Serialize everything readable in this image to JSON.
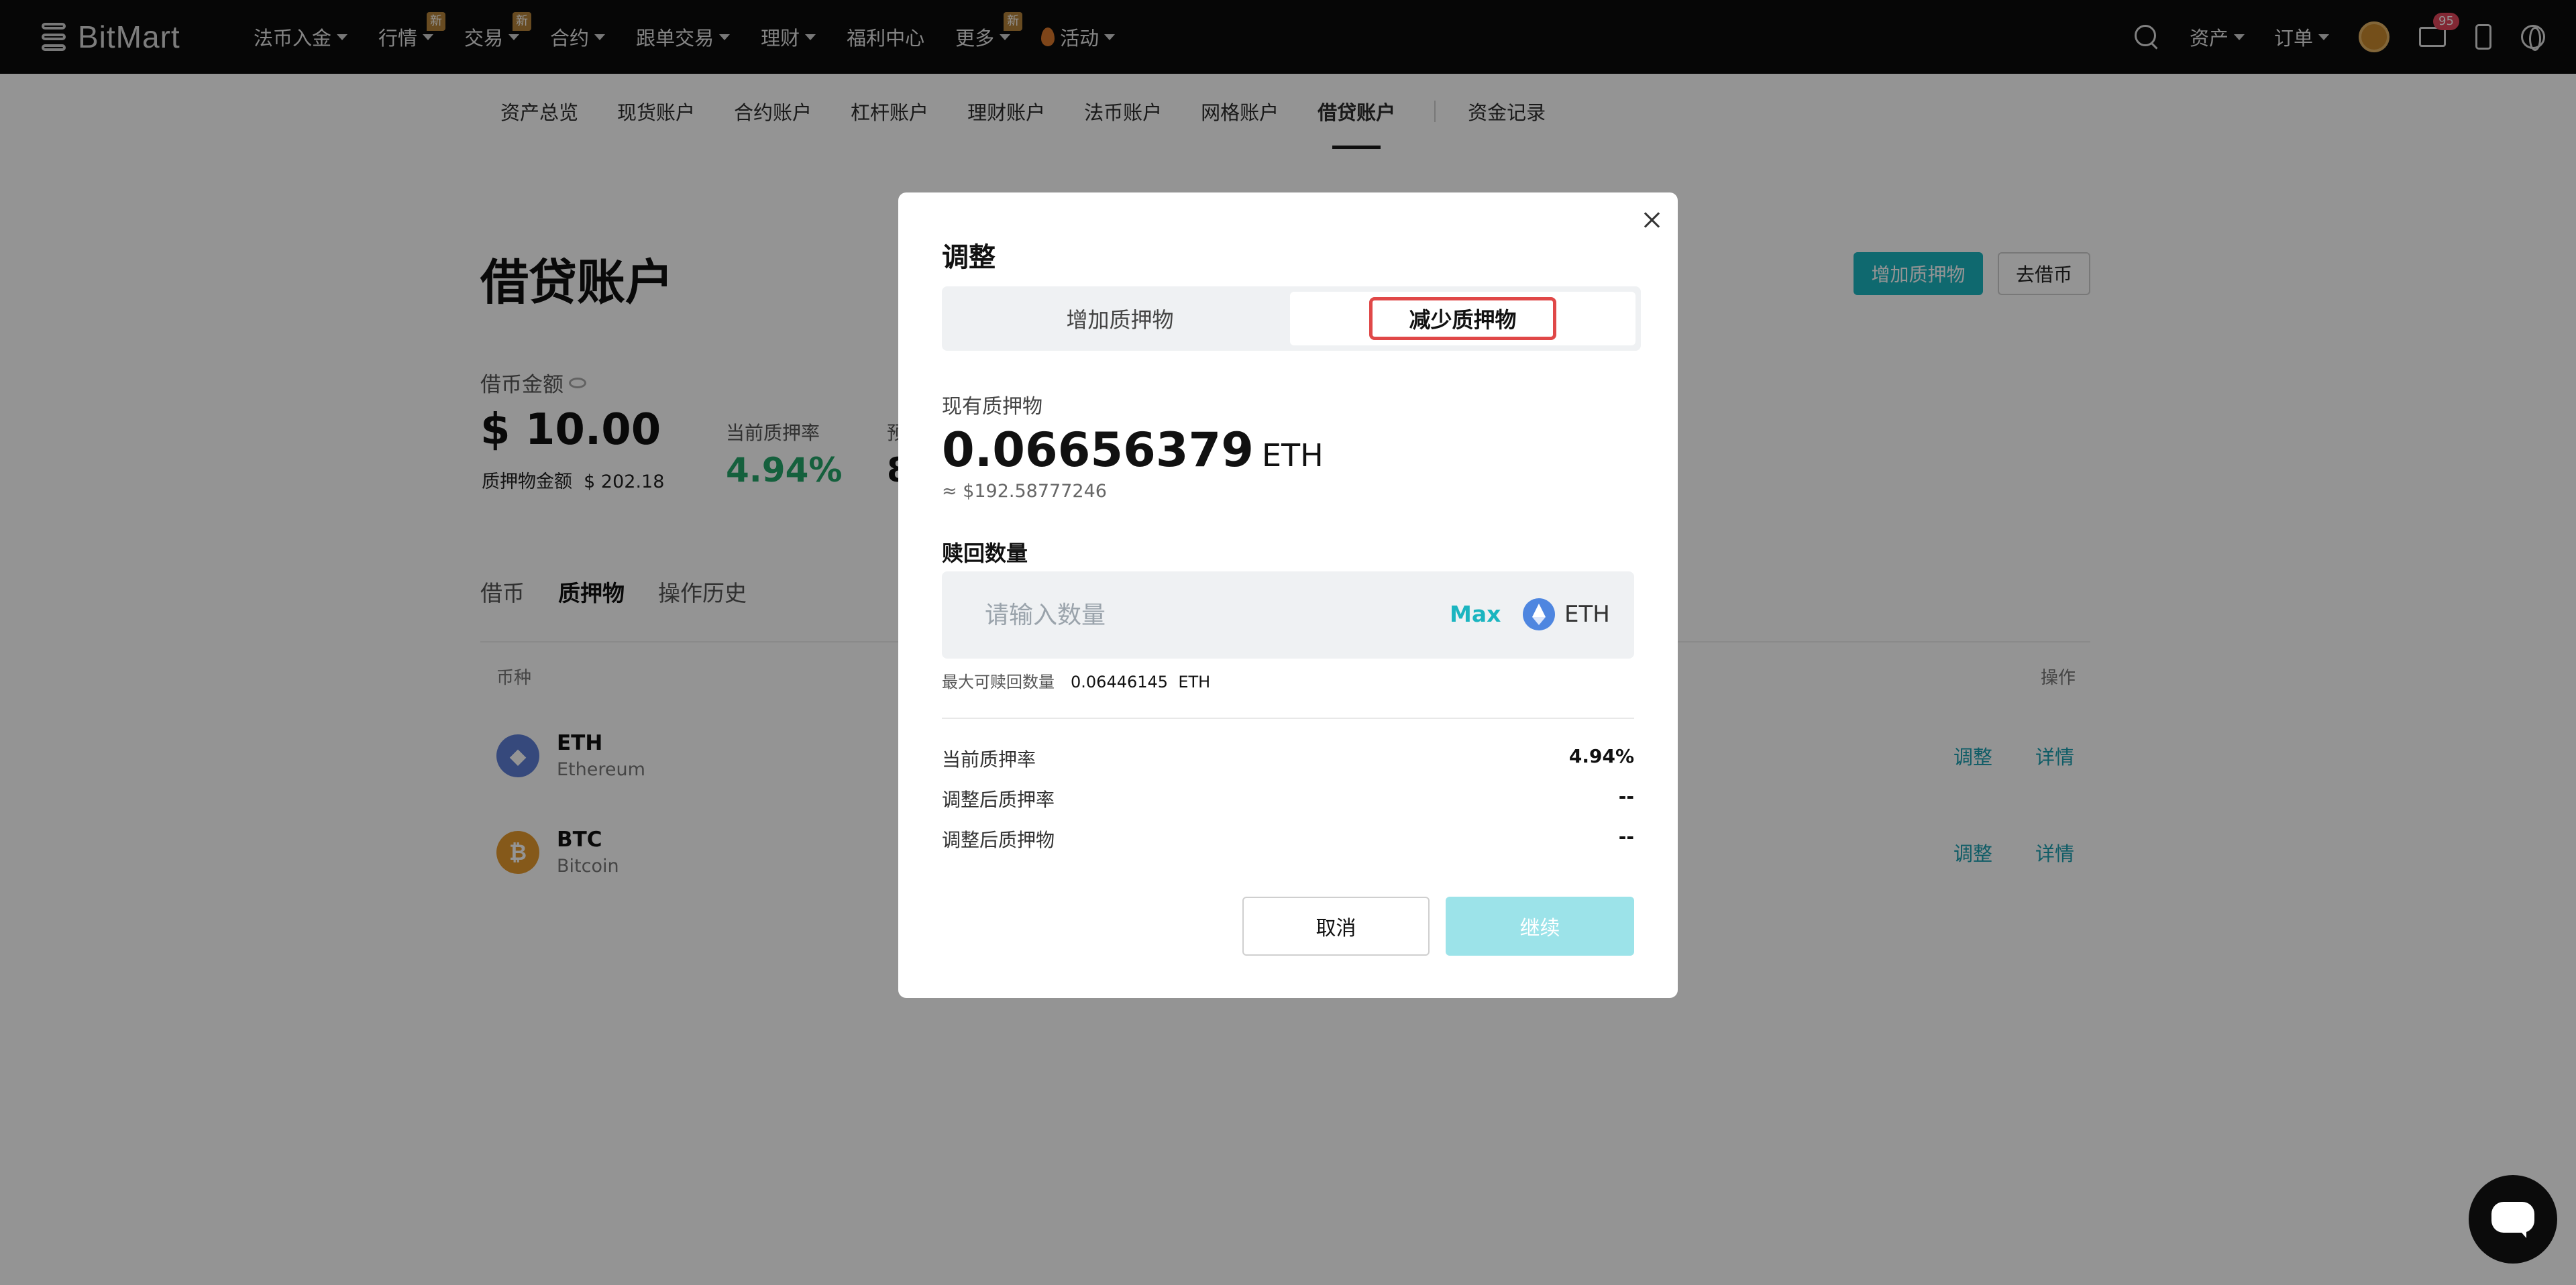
{
  "brand": {
    "logo_text": "BitMart"
  },
  "topnav": {
    "items": [
      {
        "label": "法币入金",
        "caret": true,
        "badge": ""
      },
      {
        "label": "行情",
        "caret": true,
        "badge": "新"
      },
      {
        "label": "交易",
        "caret": true,
        "badge": "新"
      },
      {
        "label": "合约",
        "caret": true,
        "badge": ""
      },
      {
        "label": "跟单交易",
        "caret": true,
        "badge": ""
      },
      {
        "label": "理财",
        "caret": true,
        "badge": ""
      },
      {
        "label": "福利中心",
        "caret": false,
        "badge": ""
      },
      {
        "label": "更多",
        "caret": true,
        "badge": "新"
      },
      {
        "label": "活动",
        "caret": true,
        "badge": ""
      }
    ],
    "right": {
      "assets": "资产",
      "orders": "订单",
      "mail_count": "95"
    }
  },
  "subtabs": [
    "资产总览",
    "现货账户",
    "合约账户",
    "杠杆账户",
    "理财账户",
    "法币账户",
    "网格账户",
    "借贷账户",
    "资金记录"
  ],
  "page": {
    "title": "借贷账户",
    "add_collateral_btn": "增加质押物",
    "borrow_btn": "去借币",
    "borrow_amount_label": "借币金额",
    "borrow_amount_value": "$ 10.00",
    "collateral_amount_label": "质押物金额",
    "collateral_amount_value": "$ 202.18",
    "current_rate_label": "当前质押率",
    "current_rate_value": "4.94%",
    "cut_label": "预",
    "cut_value": "8",
    "tabs": [
      "借币",
      "质押物",
      "操作历史"
    ],
    "table_headers": {
      "coin": "币种",
      "action": "操作"
    },
    "rows": [
      {
        "symbol": "ETH",
        "name": "Ethereum",
        "adjust": "调整",
        "detail": "详情"
      },
      {
        "symbol": "BTC",
        "name": "Bitcoin",
        "adjust": "调整",
        "detail": "详情"
      }
    ]
  },
  "modal": {
    "title": "调整",
    "seg_add": "增加质押物",
    "seg_reduce": "减少质押物",
    "current_collateral_label": "现有质押物",
    "current_collateral_value": "0.06656379",
    "current_collateral_unit": "ETH",
    "approx_value": "≈ $192.58777246",
    "redeem_label": "赎回数量",
    "input_placeholder": "请输入数量",
    "input_value": "",
    "max_label": "Max",
    "input_unit": "ETH",
    "max_redeem_label": "最大可赎回数量",
    "max_redeem_value": "0.06446145",
    "max_redeem_unit": "ETH",
    "rows": [
      {
        "label": "当前质押率",
        "value": "4.94%"
      },
      {
        "label": "调整后质押率",
        "value": "--"
      },
      {
        "label": "调整后质押物",
        "value": "--"
      }
    ],
    "cancel": "取消",
    "continue": "继续"
  },
  "colors": {
    "accent": "#1bb5c0",
    "positive": "#25a56a",
    "highlight": "#e04848"
  },
  "icons": [
    "search-icon",
    "avatar",
    "mail-icon",
    "phone-icon",
    "globe-icon",
    "close-icon",
    "eth-icon",
    "chat-icon"
  ]
}
